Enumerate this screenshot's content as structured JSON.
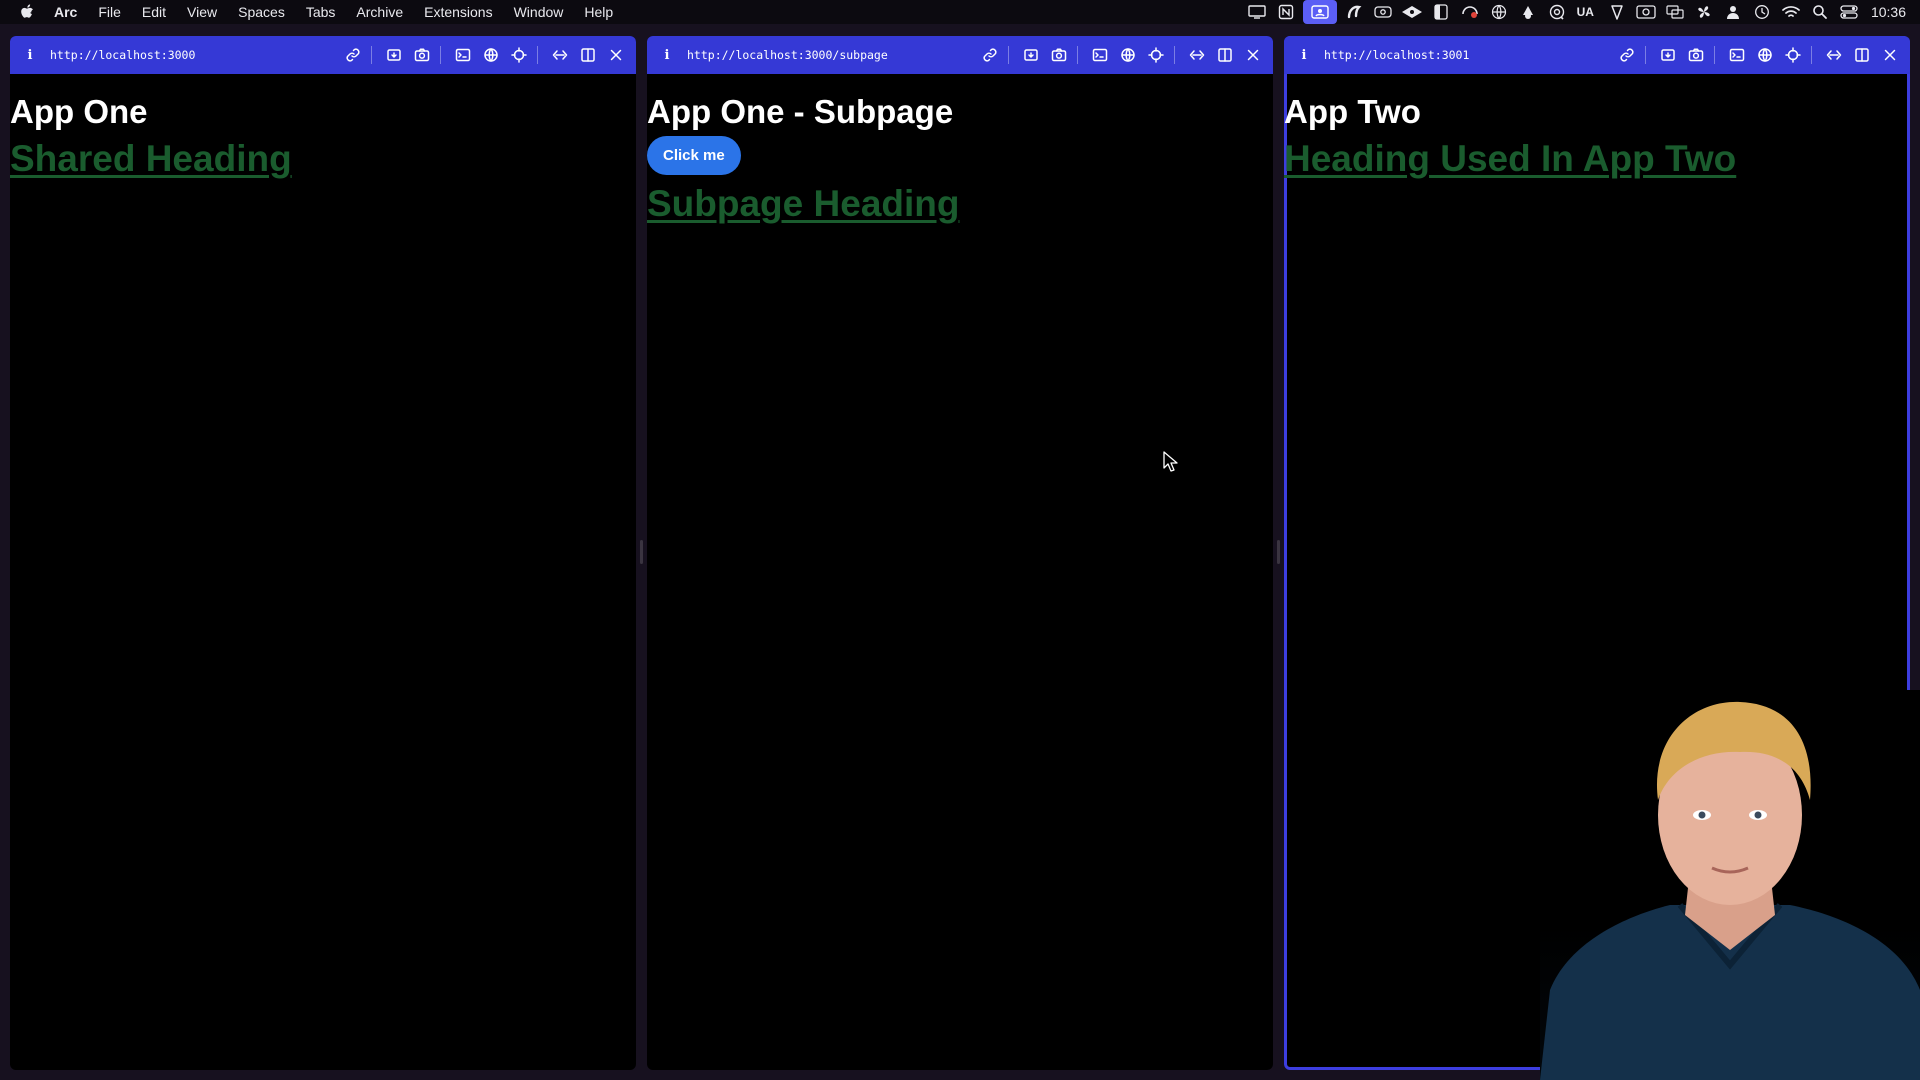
{
  "menubar": {
    "app_name": "Arc",
    "items": [
      "File",
      "Edit",
      "View",
      "Spaces",
      "Tabs",
      "Archive",
      "Extensions",
      "Window",
      "Help"
    ],
    "status_icons": [
      "display-icon",
      "notion-icon",
      "screen-share-icon",
      "arc-icon",
      "camera-icon",
      "extension-icon",
      "sidebar-icon",
      "record-icon",
      "globe-icon",
      "cloud-icon",
      "at-icon"
    ],
    "keyboard_layout": "UA",
    "status_icons_right": [
      "location-icon",
      "video-icon",
      "mirror-icon",
      "fan-icon",
      "user-icon",
      "time-machine-icon",
      "wifi-icon",
      "search-icon",
      "control-center-icon"
    ],
    "clock": "10:36"
  },
  "panes": [
    {
      "url": "http://localhost:3000",
      "title": "App One",
      "heading_link": "Shared Heading"
    },
    {
      "url": "http://localhost:3000/subpage",
      "title": "App One - Subpage",
      "button": "Click me",
      "heading_link": "Subpage Heading"
    },
    {
      "url": "http://localhost:3001",
      "title": "App Two",
      "heading_link": "Heading Used In App Two"
    }
  ],
  "colors": {
    "toolbar": "#3539d6",
    "link_green": "#1a5c2e",
    "button_blue": "#2b74e8",
    "focus_ring": "#3d3ee0"
  }
}
